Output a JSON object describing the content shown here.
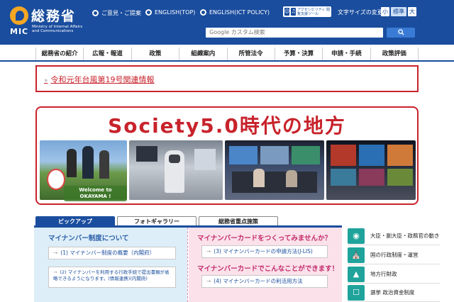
{
  "header": {
    "logo_title": "総務省",
    "logo_mic": "MIC",
    "logo_subtitle": "Ministry of Internal Affairs and Communications",
    "links": [
      "ご意見・ご提案",
      "ENGLISH(TOP)",
      "ENGLISH(ICT POLICY)"
    ],
    "a11y_badge": "アクセシビリティ 閲覧支援ツール",
    "font_size_label": "文字サイズの変更",
    "font_size_buttons": [
      "小",
      "標準",
      "大"
    ],
    "search_placeholder": "Google カスタム検索",
    "search_button_icon": "search-icon"
  },
  "nav": {
    "items": [
      "総務省の紹介",
      "広報・報道",
      "政策",
      "組織案内",
      "所管法令",
      "予算・決算",
      "申請・手続",
      "政策評価"
    ]
  },
  "notice": {
    "arrow": "»",
    "text": "令和元年台風第19号関連情報"
  },
  "banner": {
    "title": "Society5.0時代の地方",
    "caption": "Welcome to OKAYAMA !"
  },
  "tabs": [
    "ピックアップ",
    "フォトギャラリー",
    "総務省重点施策"
  ],
  "pickup": {
    "left_heading": "マイナンバー制度について",
    "left_buttons": [
      "(1) マイナンバー制度の概要（内閣府）",
      "(2) マイナンバーを利用する行政手続で提出書類が省略できるようになります。(情報連携)(内閣府)"
    ],
    "right_heading": "マイナンバーカードをつくってみませんか？",
    "right_button_1": "(3) マイナンバーカードの申請方法(J-LIS)",
    "right_heading_2": "マイナンバーカードでこんなことができます！",
    "right_button_2": "(4) マイナンバーカードの利活用方法",
    "arrow": "→"
  },
  "sidebar": {
    "items": [
      {
        "label": "大臣・副大臣・政務官の動き",
        "icon": "camera-icon"
      },
      {
        "label": "国の行政制度・運営",
        "icon": "building-icon"
      },
      {
        "label": "地方行財政",
        "icon": "map-icon"
      },
      {
        "label": "選挙 政治資金制度",
        "icon": "ballot-icon"
      }
    ]
  },
  "colors": {
    "header_blue": "#1a4d9e",
    "accent_red": "#c8232c",
    "teal": "#1fa39b"
  }
}
